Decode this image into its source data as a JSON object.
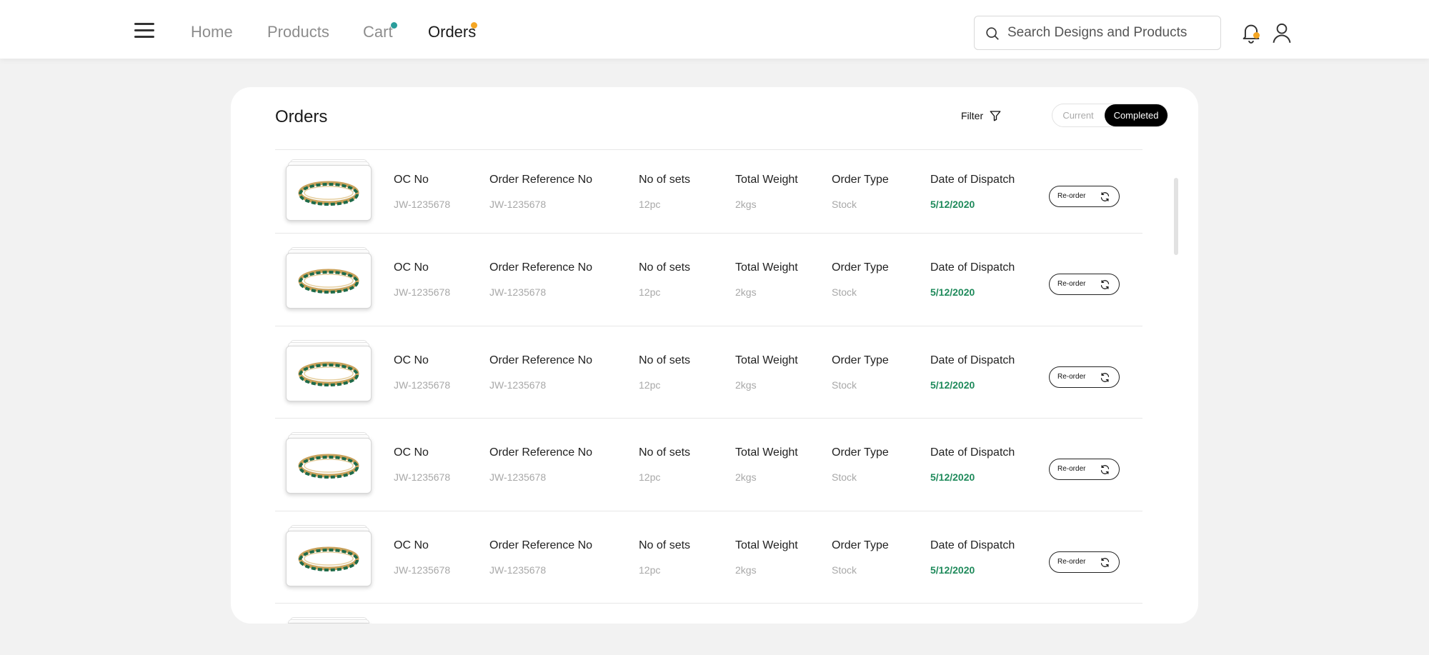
{
  "header": {
    "nav": {
      "home": "Home",
      "products": "Products",
      "cart": "Cart",
      "orders": "Orders"
    },
    "search_placeholder": "Search Designs and Products",
    "icons": [
      "menu-icon",
      "search-icon",
      "bell-icon",
      "user-icon"
    ]
  },
  "colors": {
    "accent_teal": "#2a9d9b",
    "accent_orange": "#f5a623",
    "date_green": "#1f8a5b",
    "toggle_active": "#000000"
  },
  "card": {
    "title": "Orders",
    "filter_label": "Filter",
    "toggle": {
      "current": "Current",
      "completed": "Completed",
      "selected": "Completed"
    }
  },
  "columns": {
    "oc_no": "OC No",
    "order_ref": "Order Reference No",
    "sets": "No of sets",
    "weight": "Total Weight",
    "type": "Order Type",
    "dispatch": "Date of Dispatch"
  },
  "orders": [
    {
      "oc_no": "JW-1235678",
      "order_ref": "JW-1235678",
      "sets": "12pc",
      "weight": "2kgs",
      "type": "Stock",
      "dispatch": "5/12/2020",
      "action": "Re-order"
    },
    {
      "oc_no": "JW-1235678",
      "order_ref": "JW-1235678",
      "sets": "12pc",
      "weight": "2kgs",
      "type": "Stock",
      "dispatch": "5/12/2020",
      "action": "Re-order"
    },
    {
      "oc_no": "JW-1235678",
      "order_ref": "JW-1235678",
      "sets": "12pc",
      "weight": "2kgs",
      "type": "Stock",
      "dispatch": "5/12/2020",
      "action": "Re-order"
    },
    {
      "oc_no": "JW-1235678",
      "order_ref": "JW-1235678",
      "sets": "12pc",
      "weight": "2kgs",
      "type": "Stock",
      "dispatch": "5/12/2020",
      "action": "Re-order"
    },
    {
      "oc_no": "JW-1235678",
      "order_ref": "JW-1235678",
      "sets": "12pc",
      "weight": "2kgs",
      "type": "Stock",
      "dispatch": "5/12/2020",
      "action": "Re-order"
    }
  ]
}
